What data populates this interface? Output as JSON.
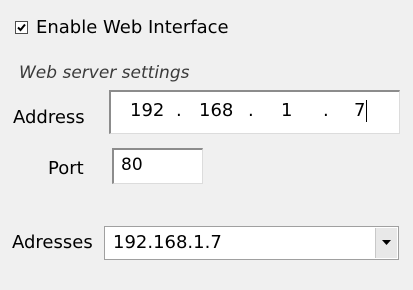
{
  "enable_web_interface": {
    "label": "Enable Web Interface",
    "checked": true
  },
  "web_server_settings": {
    "section_label": "Web server settings",
    "address": {
      "label": "Address",
      "octets": [
        "192",
        "168",
        "1",
        "7"
      ],
      "separator": "."
    },
    "port": {
      "label": "Port",
      "value": "80"
    },
    "adresses": {
      "label": "Adresses",
      "selected": "192.168.1.7"
    }
  },
  "icons": {
    "checkbox": "checkmark-icon",
    "dropdown": "chevron-down-icon"
  }
}
